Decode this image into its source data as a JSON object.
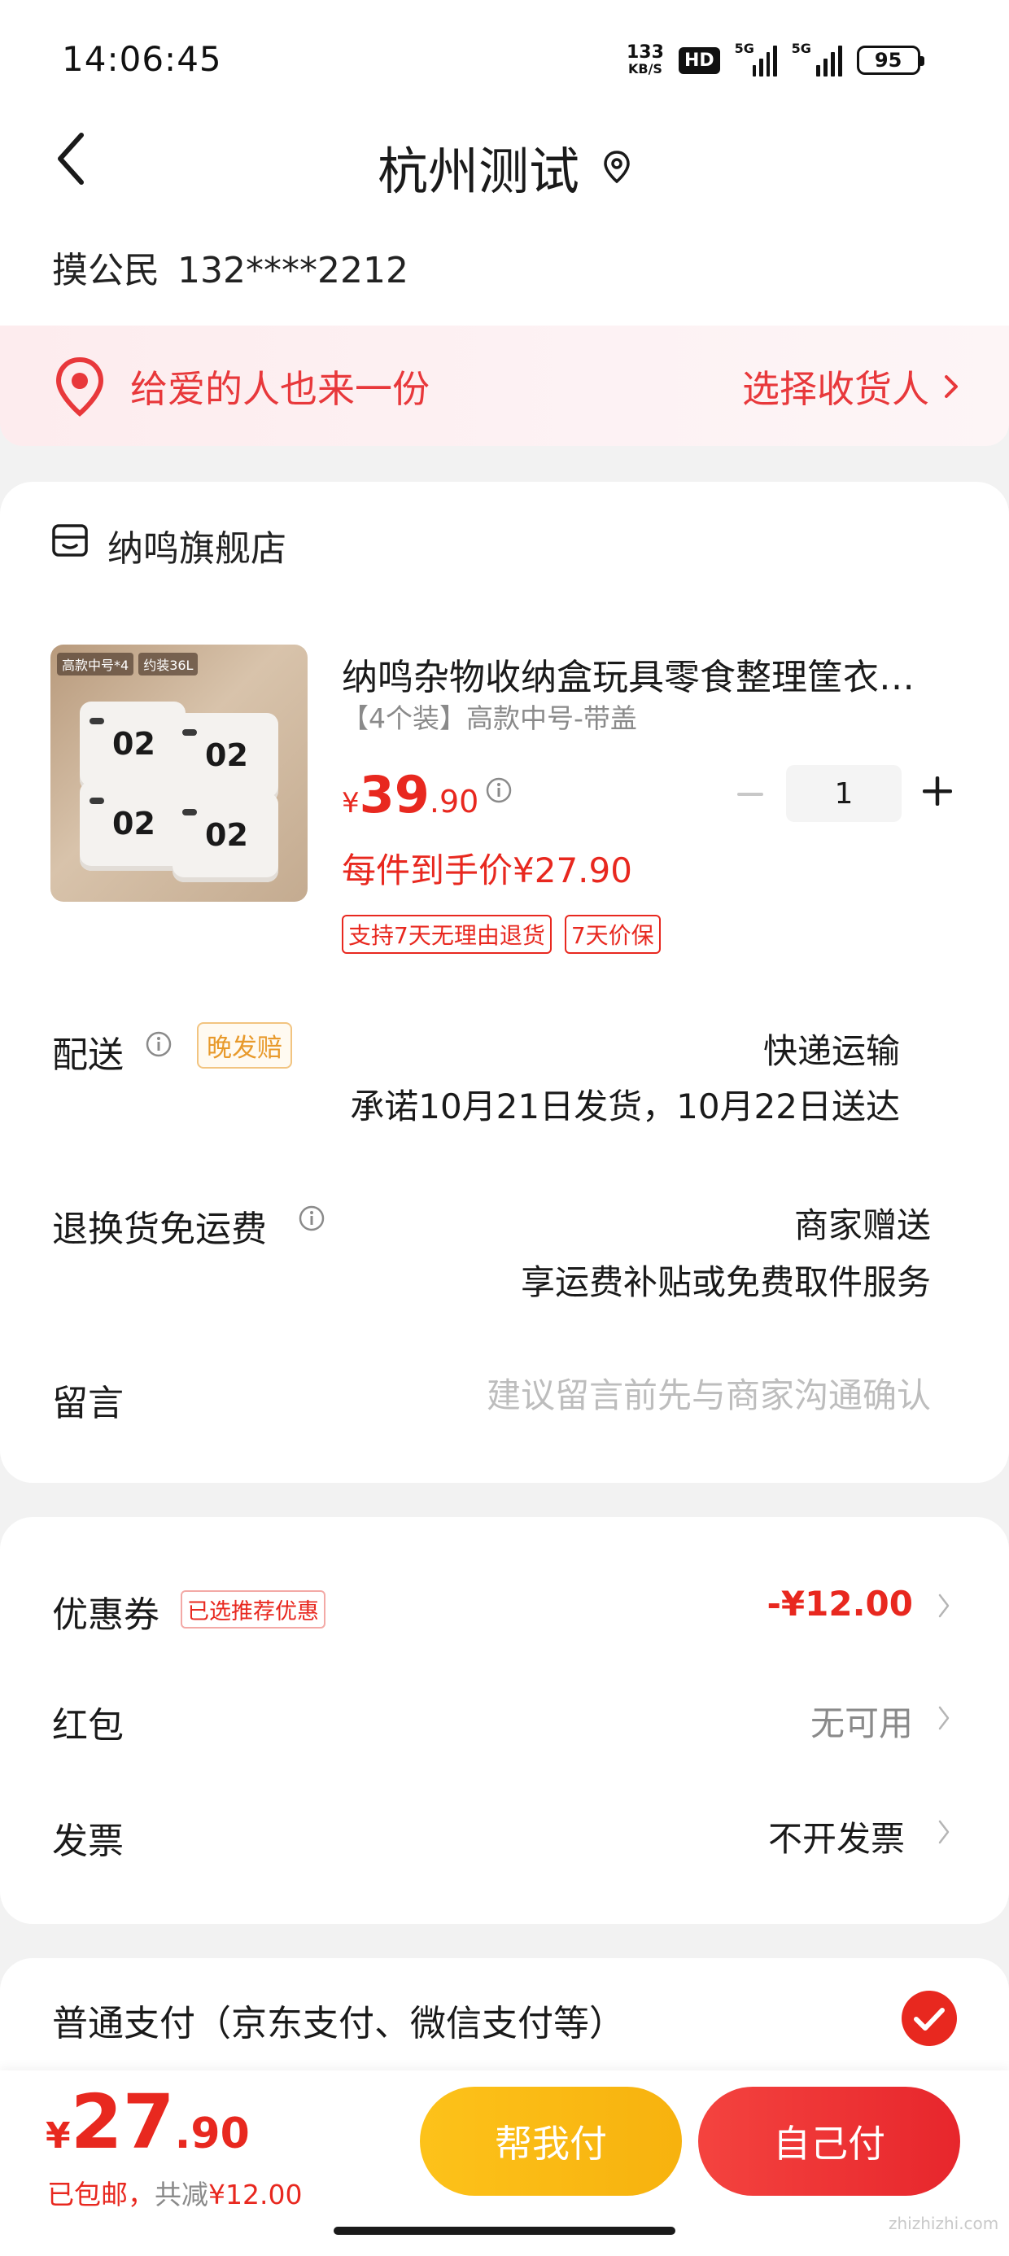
{
  "status_bar": {
    "time": "14:06:45",
    "net_speed_value": "133",
    "net_speed_unit": "KB/S",
    "hd_label": "HD",
    "signal1_label": "5G",
    "signal2_label": "5G",
    "battery": "95"
  },
  "header": {
    "title": "杭州测试",
    "contact_name": "摸公民",
    "contact_phone": "132****2212"
  },
  "gift_banner": {
    "text": "给爱的人也来一份",
    "action_label": "选择收货人"
  },
  "shop": {
    "name": "纳鸣旗舰店"
  },
  "product": {
    "image_tag_1": "高款中号*4",
    "image_tag_2": "约装36L",
    "box_label": "02",
    "title": "纳鸣杂物收纳盒玩具零食整理筐衣物储物箱",
    "spec": "【4个装】高款中号-带盖",
    "price_currency": "¥",
    "price_integer": "39",
    "price_decimal": ".90",
    "quantity": "1",
    "unit_price_label": "每件到手价¥27.90",
    "tags": [
      "支持7天无理由退货",
      "7天价保"
    ]
  },
  "delivery": {
    "label": "配送",
    "late_tag": "晚发赔",
    "method": "快递运输",
    "promise": "承诺10月21日发货，10月22日送达"
  },
  "return_shipping": {
    "label": "退换货免运费",
    "value": "商家赠送",
    "desc": "享运费补贴或免费取件服务"
  },
  "note": {
    "label": "留言",
    "placeholder": "建议留言前先与商家沟通确认"
  },
  "coupon": {
    "label": "优惠券",
    "tag": "已选推荐优惠",
    "value": "-¥12.00"
  },
  "red_packet": {
    "label": "红包",
    "value": "无可用"
  },
  "invoice": {
    "label": "发票",
    "value": "不开发票"
  },
  "payment": {
    "method": "普通支付（京东支付、微信支付等）"
  },
  "bottom_bar": {
    "total_currency": "¥",
    "total_integer": "27",
    "total_decimal": ".90",
    "shipping_label": "已包邮，",
    "saved_prefix": "共减",
    "saved_amount": "¥12.00",
    "help_pay_label": "帮我付",
    "self_pay_label": "自己付"
  },
  "watermark": "zhizhizhi.com",
  "colors": {
    "accent_red": "#e8281f",
    "help_pay_yellow": "#fdc21a",
    "self_pay_red": "#e7262c"
  }
}
